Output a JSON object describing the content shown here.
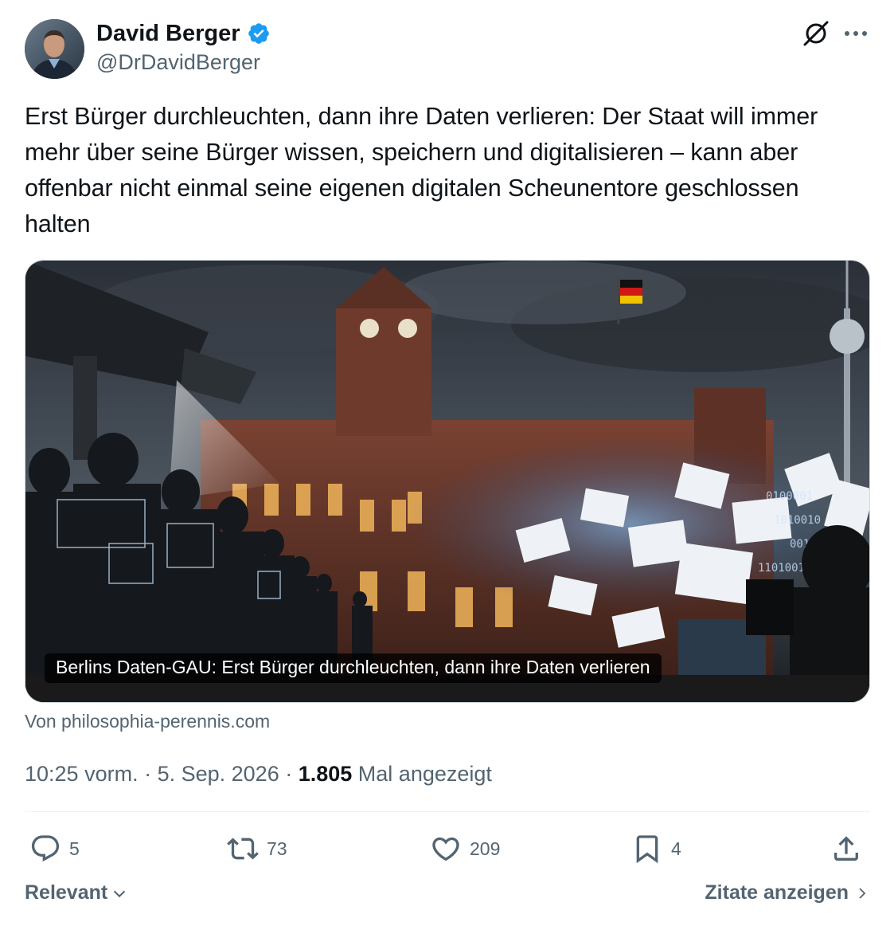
{
  "author": {
    "display_name": "David Berger",
    "handle": "@DrDavidBerger",
    "verified": true
  },
  "header_icons": {
    "grok": "grok-icon",
    "more": "more-icon"
  },
  "tweet": {
    "text": "Erst Bürger durchleuchten, dann ihre Daten verlieren: Der Staat will immer mehr über seine Bürger wissen, speichern und digitalisieren – kann aber offenbar nicht einmal seine eigenen digitalen Scheunentore geschlossen halten"
  },
  "card": {
    "caption": "Berlins Daten-GAU: Erst Bürger durchleuchten, dann ihre Daten verlieren",
    "source": "Von philosophia-perennis.com"
  },
  "meta": {
    "time": "10:25 vorm.",
    "separator1": " · ",
    "date": "5. Sep. 2026",
    "separator2": " · ",
    "views": "1.805",
    "views_label": " Mal angezeigt"
  },
  "actions": {
    "replies": "5",
    "reposts": "73",
    "likes": "209",
    "bookmarks": "4"
  },
  "footer": {
    "sort_label": "Relevant",
    "quotes_label": "Zitate anzeigen"
  },
  "colors": {
    "text_primary": "#0f1419",
    "text_secondary": "#536471",
    "verified_blue": "#1d9bf0",
    "divider": "#eff3f4"
  }
}
